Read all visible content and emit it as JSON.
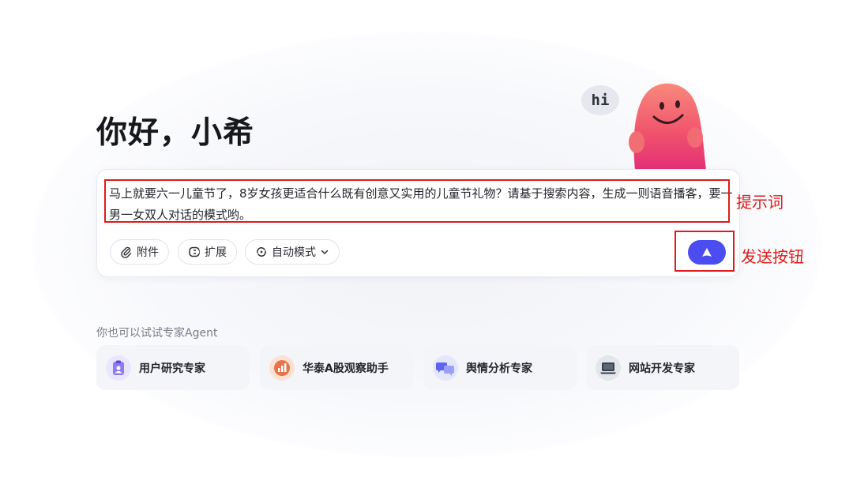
{
  "greeting": "你好，小希",
  "mascot_bubble": "hi",
  "prompt": {
    "text": "马上就要六一儿童节了，8岁女孩更适合什么既有创意又实用的儿童节礼物？请基于搜索内容，生成一则语音播客，要一男一女双人对话的模式哟。"
  },
  "toolbar": {
    "attach_label": "附件",
    "extend_label": "扩展",
    "mode_label": "自动模式"
  },
  "annotations": {
    "prompt_label": "提示词",
    "send_label": "发送按钮"
  },
  "agents": {
    "section_label": "你也可以试试专家Agent",
    "items": [
      {
        "name": "用户研究专家",
        "icon": "clipboard-user-icon",
        "color": "#8e7cf0"
      },
      {
        "name": "华泰A股观察助手",
        "icon": "stock-chart-icon",
        "color": "#e8734a"
      },
      {
        "name": "舆情分析专家",
        "icon": "chat-bubbles-icon",
        "color": "#5c64f0"
      },
      {
        "name": "网站开发专家",
        "icon": "laptop-icon",
        "color": "#3a3f4c"
      }
    ]
  },
  "colors": {
    "accent": "#4b4df1",
    "annotation_red": "#e01a1a",
    "mascot": "#f2506f"
  }
}
